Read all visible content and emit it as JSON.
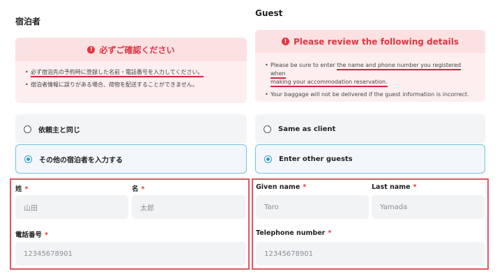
{
  "left": {
    "title": "宿泊者",
    "alert": {
      "icon": "exclamation-circle-icon",
      "title": "必ずご確認ください",
      "lines": [
        "必ず宿泊先の予約時に登録した名前・電話番号を入力してください。",
        "宿泊者情報に誤りがある場合、荷物を配送することができません。"
      ]
    },
    "options": [
      {
        "label": "依頼主と同じ",
        "selected": false
      },
      {
        "label": "その他の宿泊者を入力する",
        "selected": true
      }
    ],
    "form": {
      "last_name_label": "姓",
      "first_name_label": "名",
      "last_name_placeholder": "山田",
      "first_name_placeholder": "太郎",
      "phone_label": "電話番号",
      "phone_placeholder": "12345678901",
      "required_mark": "*"
    }
  },
  "right": {
    "title": "Guest",
    "alert": {
      "icon": "exclamation-circle-icon",
      "title": "Please review the following details",
      "line1_part1": "Please be sure to enter ",
      "line1_part2": "the name and phone number you registered when",
      "line1_part3": "making your accommodation reservation.",
      "line2": "Your baggage will not be delivered if the guest information is incorrect."
    },
    "options": [
      {
        "label": "Same as client",
        "selected": false
      },
      {
        "label": "Enter other guests",
        "selected": true
      }
    ],
    "form": {
      "given_name_label": "Given name",
      "last_name_label": "Last name",
      "given_name_placeholder": "Taro",
      "last_name_placeholder": "Yamada",
      "phone_label": "Telephone number",
      "phone_placeholder": "12345678901",
      "required_mark": "*"
    }
  },
  "colors": {
    "alert_red": "#e1353f",
    "highlight_outline": "#e05560",
    "selected_border": "#6fc3de"
  }
}
